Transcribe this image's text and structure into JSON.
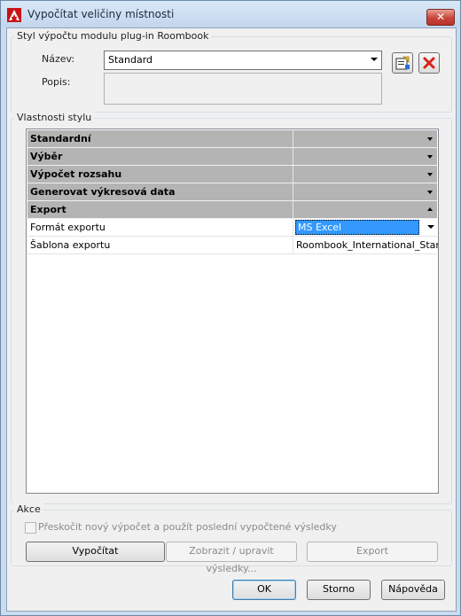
{
  "window": {
    "title": "Vypočítat veličiny místnosti",
    "close_label": "✕"
  },
  "style_group": {
    "title": "Styl výpočtu modulu plug-in Roombook",
    "name_label": "Název:",
    "name_value": "Standard",
    "description_label": "Popis:",
    "description_value": ""
  },
  "properties_group": {
    "title": "Vlastnosti stylu",
    "categories": [
      {
        "label": "Standardní",
        "expanded": false
      },
      {
        "label": "Výběr",
        "expanded": false
      },
      {
        "label": "Výpočet rozsahu",
        "expanded": false
      },
      {
        "label": "Generovat výkresová data",
        "expanded": false
      },
      {
        "label": "Export",
        "expanded": true
      }
    ],
    "export_properties": [
      {
        "label": "Formát exportu",
        "value": "MS Excel"
      },
      {
        "label": "Šablona exportu",
        "value": "Roombook_International_Star"
      }
    ]
  },
  "actions_group": {
    "title": "Akce",
    "skip_checkbox_label": "Přeskočit nový výpočet a použít poslední vypočtené výsledky",
    "calculate_label": "Vypočítat",
    "show_edit_label": "Zobrazit / upravit výsledky...",
    "export_label": "Export"
  },
  "footer": {
    "ok_label": "OK",
    "cancel_label": "Storno",
    "help_label": "Nápověda"
  },
  "icons": {
    "app": "autocad-logo-icon",
    "edit_style": "edit-style-icon",
    "delete_style": "delete-x-icon"
  },
  "colors": {
    "category_bg": "#b4b4b4",
    "selection": "#3399ff",
    "close_red": "#c8453a"
  }
}
